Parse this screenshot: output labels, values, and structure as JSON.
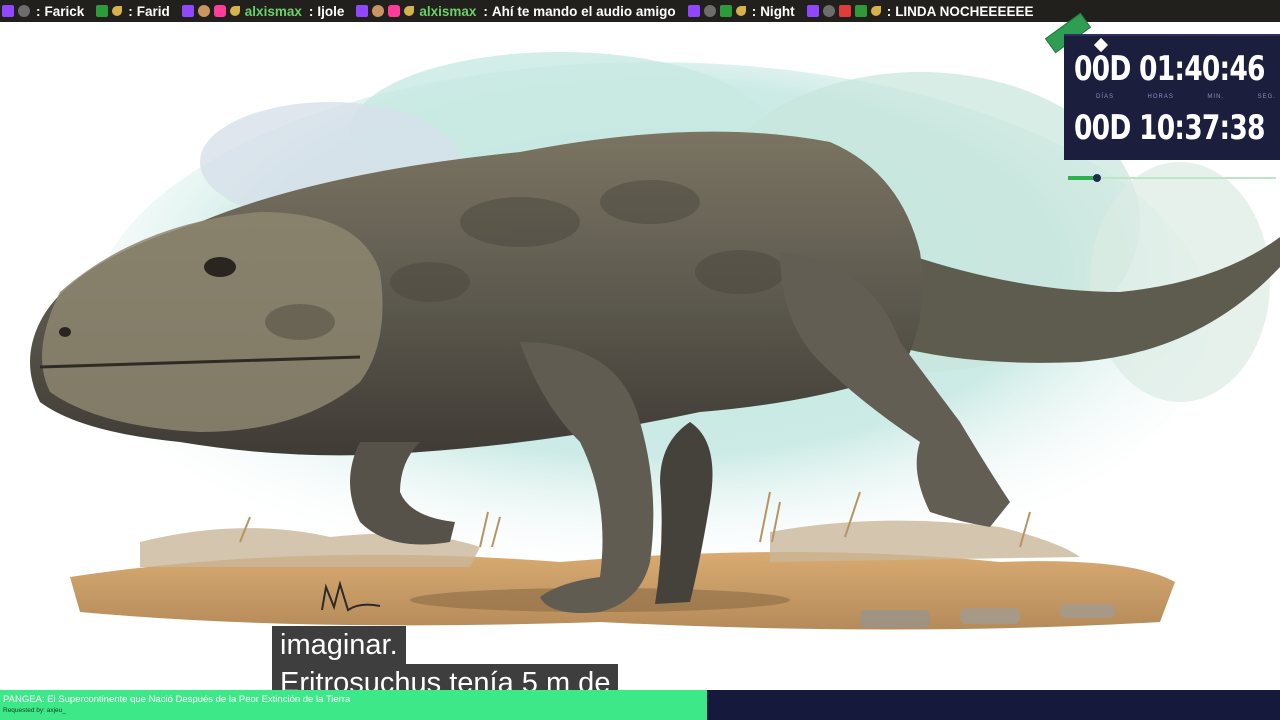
{
  "chat_ticker": [
    {
      "user": "",
      "text": "Farick",
      "badges": [
        "twitch-icon",
        "avatar-icon"
      ]
    },
    {
      "user": "",
      "text": "Farid",
      "badges": [
        "puzzle-icon",
        "key-icon"
      ]
    },
    {
      "user": "alxismax",
      "text": "Ijole",
      "badges": [
        "twitch-icon",
        "face-icon",
        "heart-icon",
        "key-icon"
      ]
    },
    {
      "user": "alxismax",
      "text": "Ahí te mando el audio amigo",
      "badges": [
        "twitch-icon",
        "face-icon",
        "heart-icon",
        "key-icon"
      ]
    },
    {
      "user": "",
      "text": "Night",
      "badges": [
        "twitch-icon",
        "avatar-icon",
        "puzzle-icon",
        "key-icon"
      ]
    },
    {
      "user": "",
      "text": "LINDA NOCHEEEEEE",
      "badges": [
        "twitch-icon",
        "avatar-icon",
        "video-icon",
        "puzzle-icon",
        "key-icon"
      ]
    }
  ],
  "timer": {
    "row1": "00D 01:40:46",
    "row2": "00D 10:37:38",
    "labels": [
      "DÍAS",
      "HORAS",
      "MIN.",
      "SEG."
    ]
  },
  "progress": {
    "fraction": 0.14
  },
  "subtitles": {
    "line1": "imaginar.",
    "line2": "Eritrosuchus tenía 5 m de"
  },
  "now_playing": {
    "title": "PANGEA: El Supercontinente que Nació Después de la Peor Extinción de la Tierra",
    "requested_by": "Requested by: axjeu_"
  },
  "colors": {
    "ticker_bg": "#22201d",
    "timer_bg": "#1c1e3e",
    "bar_green": "#3de888",
    "bar_navy": "#151a3d",
    "progress_green": "#2fb04e"
  }
}
